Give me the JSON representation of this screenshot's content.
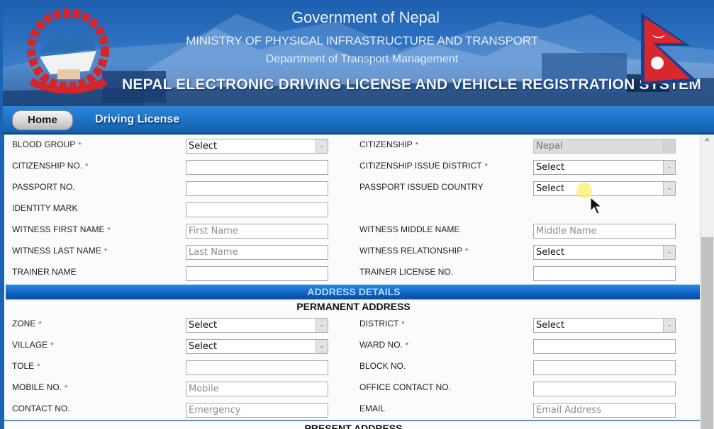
{
  "header": {
    "line1": "Government of Nepal",
    "line2": "MINISTRY OF PHYSICAL INFRASTRUCTURE AND TRANSPORT",
    "line3": "Department of Transport Management",
    "system_title": "NEPAL ELECTRONIC DRIVING LICENSE AND VEHICLE REGISTRATION SYSTEM",
    "emblem_icon": "nepal-emblem-icon",
    "flag_icon": "nepal-flag-icon"
  },
  "nav": {
    "home_label": "Home",
    "driving_license_label": "Driving License"
  },
  "form": {
    "personal_rows": [
      {
        "left": {
          "label": "BLOOD GROUP",
          "required": true,
          "type": "select",
          "value": "Select",
          "placeholder": ""
        },
        "right": {
          "label": "CITIZENSHIP",
          "required": true,
          "type": "select",
          "value": "Nepal",
          "disabled": true,
          "placeholder": ""
        }
      },
      {
        "left": {
          "label": "CITIZENSHIP NO.",
          "required": true,
          "type": "text",
          "value": "",
          "placeholder": ""
        },
        "right": {
          "label": "CITIZENSHIP ISSUE DISTRICT",
          "required": true,
          "type": "select",
          "value": "Select",
          "placeholder": ""
        }
      },
      {
        "left": {
          "label": "PASSPORT NO.",
          "required": false,
          "type": "text",
          "value": "",
          "placeholder": ""
        },
        "right": {
          "label": "PASSPORT ISSUED COUNTRY",
          "required": false,
          "type": "select",
          "value": "Select",
          "placeholder": ""
        }
      },
      {
        "left": {
          "label": "IDENTITY MARK",
          "required": false,
          "type": "text",
          "value": "",
          "placeholder": ""
        },
        "right": null
      },
      {
        "left": {
          "label": "WITNESS FIRST NAME",
          "required": true,
          "type": "text",
          "value": "",
          "placeholder": "First Name"
        },
        "right": {
          "label": "WITNESS MIDDLE NAME",
          "required": false,
          "type": "text",
          "value": "",
          "placeholder": "Middle Name"
        }
      },
      {
        "left": {
          "label": "WITNESS LAST NAME",
          "required": true,
          "type": "text",
          "value": "",
          "placeholder": "Last Name"
        },
        "right": {
          "label": "WITNESS RELATIONSHIP",
          "required": true,
          "type": "select",
          "value": "Select",
          "placeholder": ""
        }
      },
      {
        "left": {
          "label": "TRAINER NAME",
          "required": false,
          "type": "text",
          "value": "",
          "placeholder": ""
        },
        "right": {
          "label": "TRAINER LICENSE NO.",
          "required": false,
          "type": "text",
          "value": "",
          "placeholder": ""
        }
      }
    ],
    "address_section_title": "ADDRESS DETAILS",
    "permanent_title": "PERMANENT ADDRESS",
    "permanent_rows": [
      {
        "left": {
          "label": "ZONE",
          "required": true,
          "type": "select",
          "value": "Select",
          "placeholder": ""
        },
        "right": {
          "label": "DISTRICT",
          "required": true,
          "type": "select",
          "value": "Select",
          "placeholder": ""
        }
      },
      {
        "left": {
          "label": "VILLAGE",
          "required": true,
          "type": "select",
          "value": "Select",
          "placeholder": ""
        },
        "right": {
          "label": "WARD NO.",
          "required": true,
          "type": "text",
          "value": "",
          "placeholder": ""
        }
      },
      {
        "left": {
          "label": "TOLE",
          "required": true,
          "type": "text",
          "value": "",
          "placeholder": ""
        },
        "right": {
          "label": "BLOCK NO.",
          "required": false,
          "type": "text",
          "value": "",
          "placeholder": ""
        }
      },
      {
        "left": {
          "label": "MOBILE NO.",
          "required": true,
          "type": "text",
          "value": "",
          "placeholder": "Mobile"
        },
        "right": {
          "label": "OFFICE CONTACT NO.",
          "required": false,
          "type": "text",
          "value": "",
          "placeholder": ""
        }
      },
      {
        "left": {
          "label": "CONTACT NO.",
          "required": false,
          "type": "text",
          "value": "",
          "placeholder": "Emergency"
        },
        "right": {
          "label": "EMAIL",
          "required": false,
          "type": "text",
          "value": "",
          "placeholder": "Email Address"
        }
      }
    ],
    "present_title": "PRESENT ADDRESS",
    "required_marker": "*",
    "select_arrow": "⌄"
  },
  "scrollbar": {
    "up_arrow": "^"
  }
}
